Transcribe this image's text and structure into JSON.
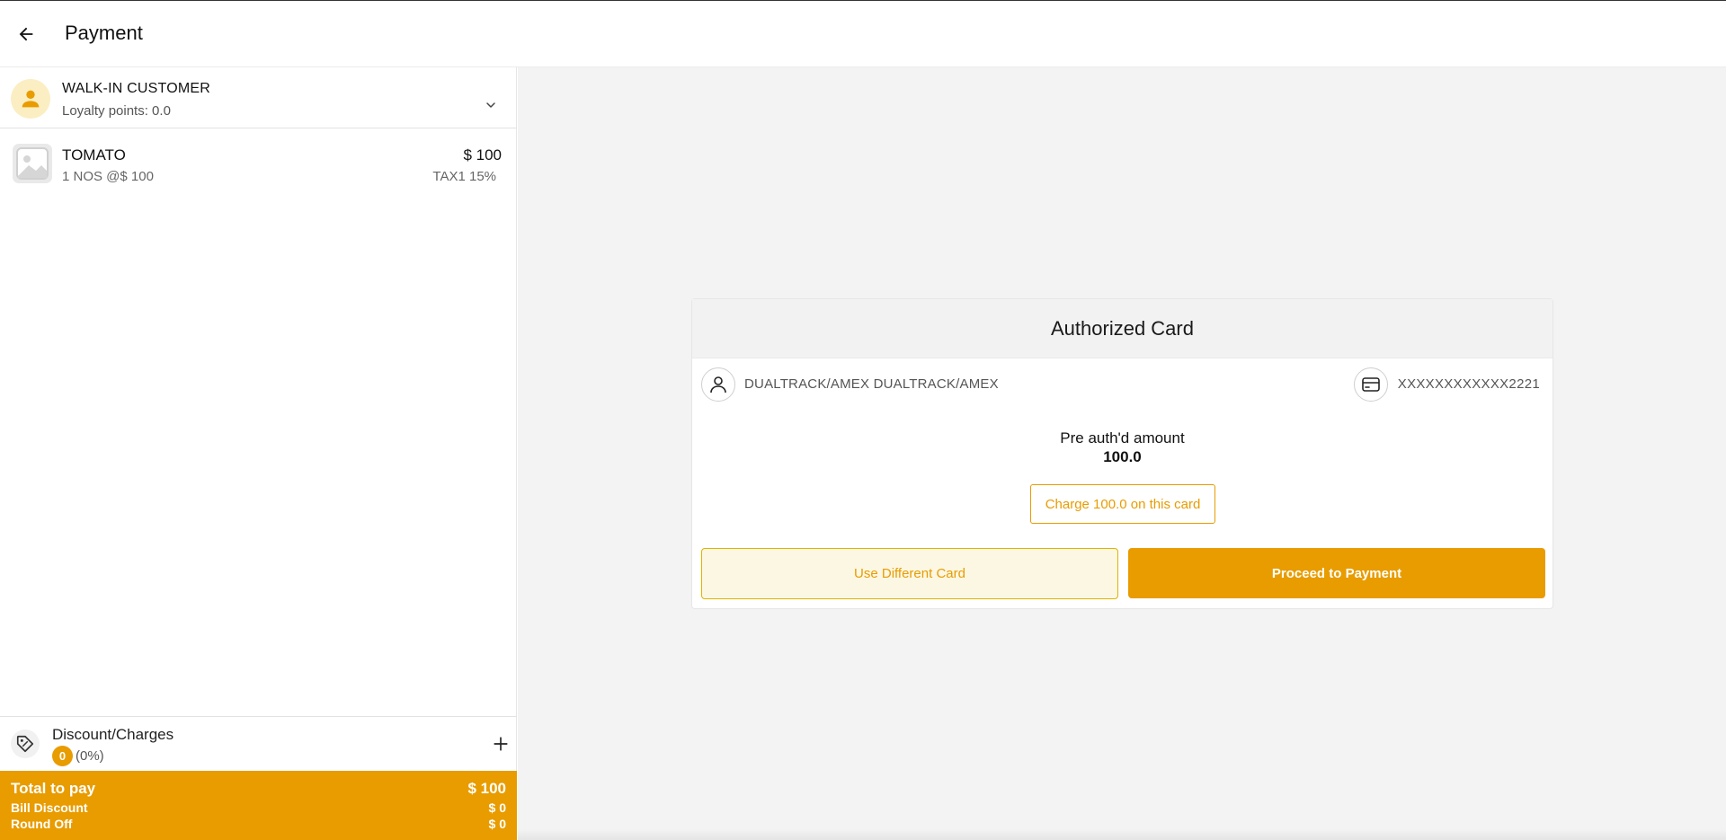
{
  "header": {
    "title": "Payment",
    "back_icon": "arrow-left-icon"
  },
  "customer": {
    "name": "WALK-IN CUSTOMER",
    "loyalty": "Loyalty points: 0.0",
    "avatar_icon": "person-icon",
    "expand_icon": "chevron-down-icon"
  },
  "cart": {
    "items": [
      {
        "name": "TOMATO",
        "qty_text": "1 NOS @$ 100",
        "price": "$ 100",
        "tax": "TAX1 15%",
        "thumb_icon": "image-placeholder-icon"
      }
    ]
  },
  "discount": {
    "label": "Discount/Charges",
    "count": "0",
    "percent": "(0%)",
    "icon": "tag-icon",
    "add_icon": "plus-icon"
  },
  "totals": {
    "total_label": "Total to pay",
    "total_value": "$ 100",
    "bill_discount_label": "Bill Discount",
    "bill_discount_value": "$ 0",
    "round_off_label": "Round Off",
    "round_off_value": "$ 0"
  },
  "authorized_card": {
    "title": "Authorized Card",
    "holder": "DUALTRACK/AMEX DUALTRACK/AMEX",
    "holder_icon": "user-icon",
    "card_number": "XXXXXXXXXXXX2221",
    "card_icon": "credit-card-icon",
    "preauth_label": "Pre auth'd amount",
    "preauth_amount": "100.0",
    "charge_button": "Charge 100.0 on this card",
    "different_card_button": "Use Different Card",
    "proceed_button": "Proceed to Payment"
  },
  "colors": {
    "accent": "#e89c00",
    "accent_light": "#fbf7e3",
    "panel_bg": "#f3f3f3"
  }
}
